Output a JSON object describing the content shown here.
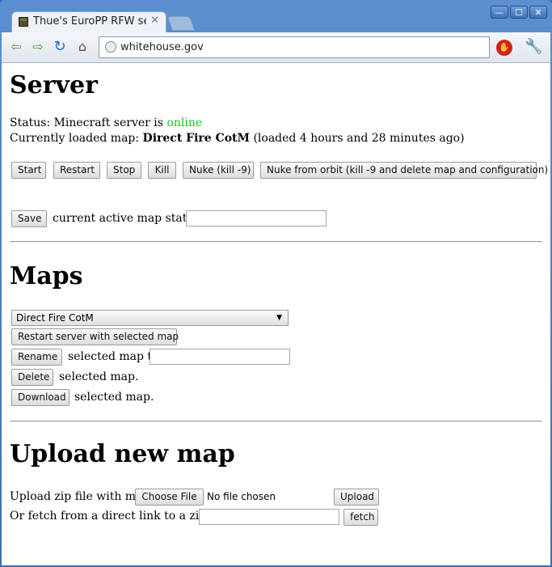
{
  "browser": {
    "tab_title": "Thue's EuroPP RFW ser",
    "address": "whitehouse.gov",
    "window_buttons": [
      "—",
      "☐",
      "✕"
    ]
  },
  "server": {
    "heading": "Server",
    "status_prefix": "Status: Minecraft server is",
    "status_value": "online",
    "loaded_prefix": "Currently loaded map:",
    "loaded_map": "Direct Fire CotM",
    "loaded_suffix": "(loaded 4 hours and 28 minutes ago)",
    "buttons": {
      "start": "Start",
      "restart": "Restart",
      "stop": "Stop",
      "kill": "Kill",
      "nuke": "Nuke (kill -9)",
      "nuke_orbit": "Nuke from orbit (kill -9 and delete map and configuration)"
    },
    "save_button": "Save",
    "save_text": "current active map state as",
    "save_value": ""
  },
  "maps": {
    "heading": "Maps",
    "selected": "Direct Fire CotM",
    "restart_selected": "Restart server with selected map",
    "rename_button": "Rename",
    "rename_text": "selected map to",
    "rename_value": "",
    "delete_button": "Delete",
    "delete_text": "selected map.",
    "download_button": "Download",
    "download_text": "selected map."
  },
  "upload": {
    "heading": "Upload new map",
    "zip_label": "Upload zip file with map:",
    "choose_file": "Choose File",
    "no_file": "No file chosen",
    "upload_button": "Upload",
    "fetch_label": "Or fetch from a direct link to a zip file:",
    "fetch_value": "",
    "fetch_button": "fetch"
  },
  "colors": {
    "online": "#1ec21e",
    "frame": "#3d6fb3"
  }
}
